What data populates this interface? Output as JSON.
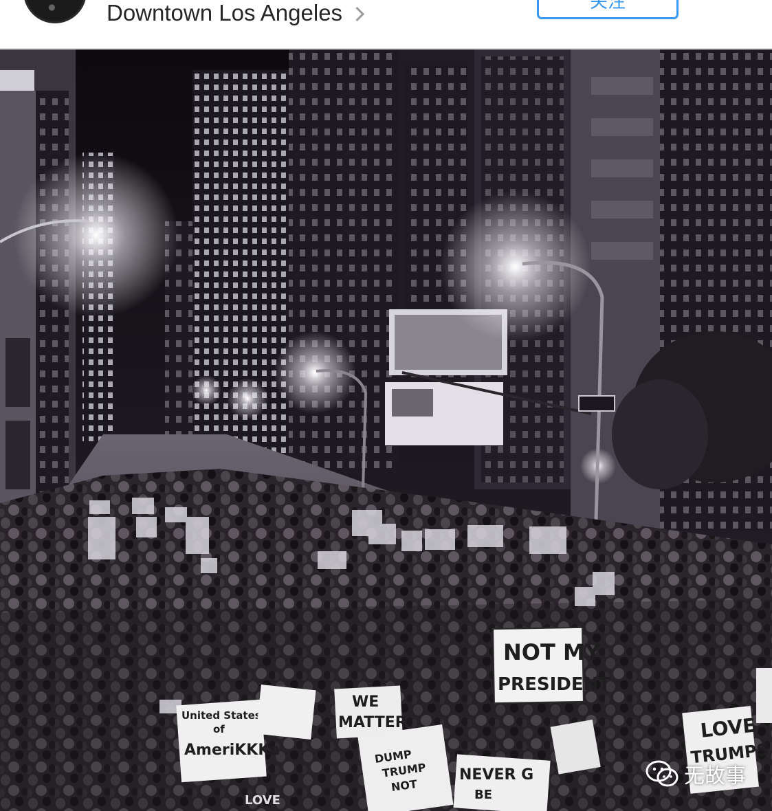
{
  "header": {
    "location": "Downtown Los Angeles",
    "follow_label": "关注"
  },
  "photo": {
    "signs": {
      "not_my_president": [
        "NOT MY",
        "PRESIDENT"
      ],
      "united_states": [
        "United States",
        "of",
        "AmeriKKKa"
      ],
      "we_matter": [
        "WE",
        "MATTER"
      ],
      "dump_trump": [
        "DUMP",
        "TRUMP",
        "NOT"
      ],
      "never": [
        "NEVER G",
        "BE"
      ],
      "love_trumps": [
        "LOVE",
        "TRUMPS"
      ],
      "love_small": "LOVE"
    },
    "colors": {
      "sky": "#141016",
      "building": "#2a2630",
      "crowd": "#241f24",
      "sign": "#f2f2f2"
    }
  },
  "watermark": {
    "icon": "wechat-icon",
    "text": "无故事"
  }
}
